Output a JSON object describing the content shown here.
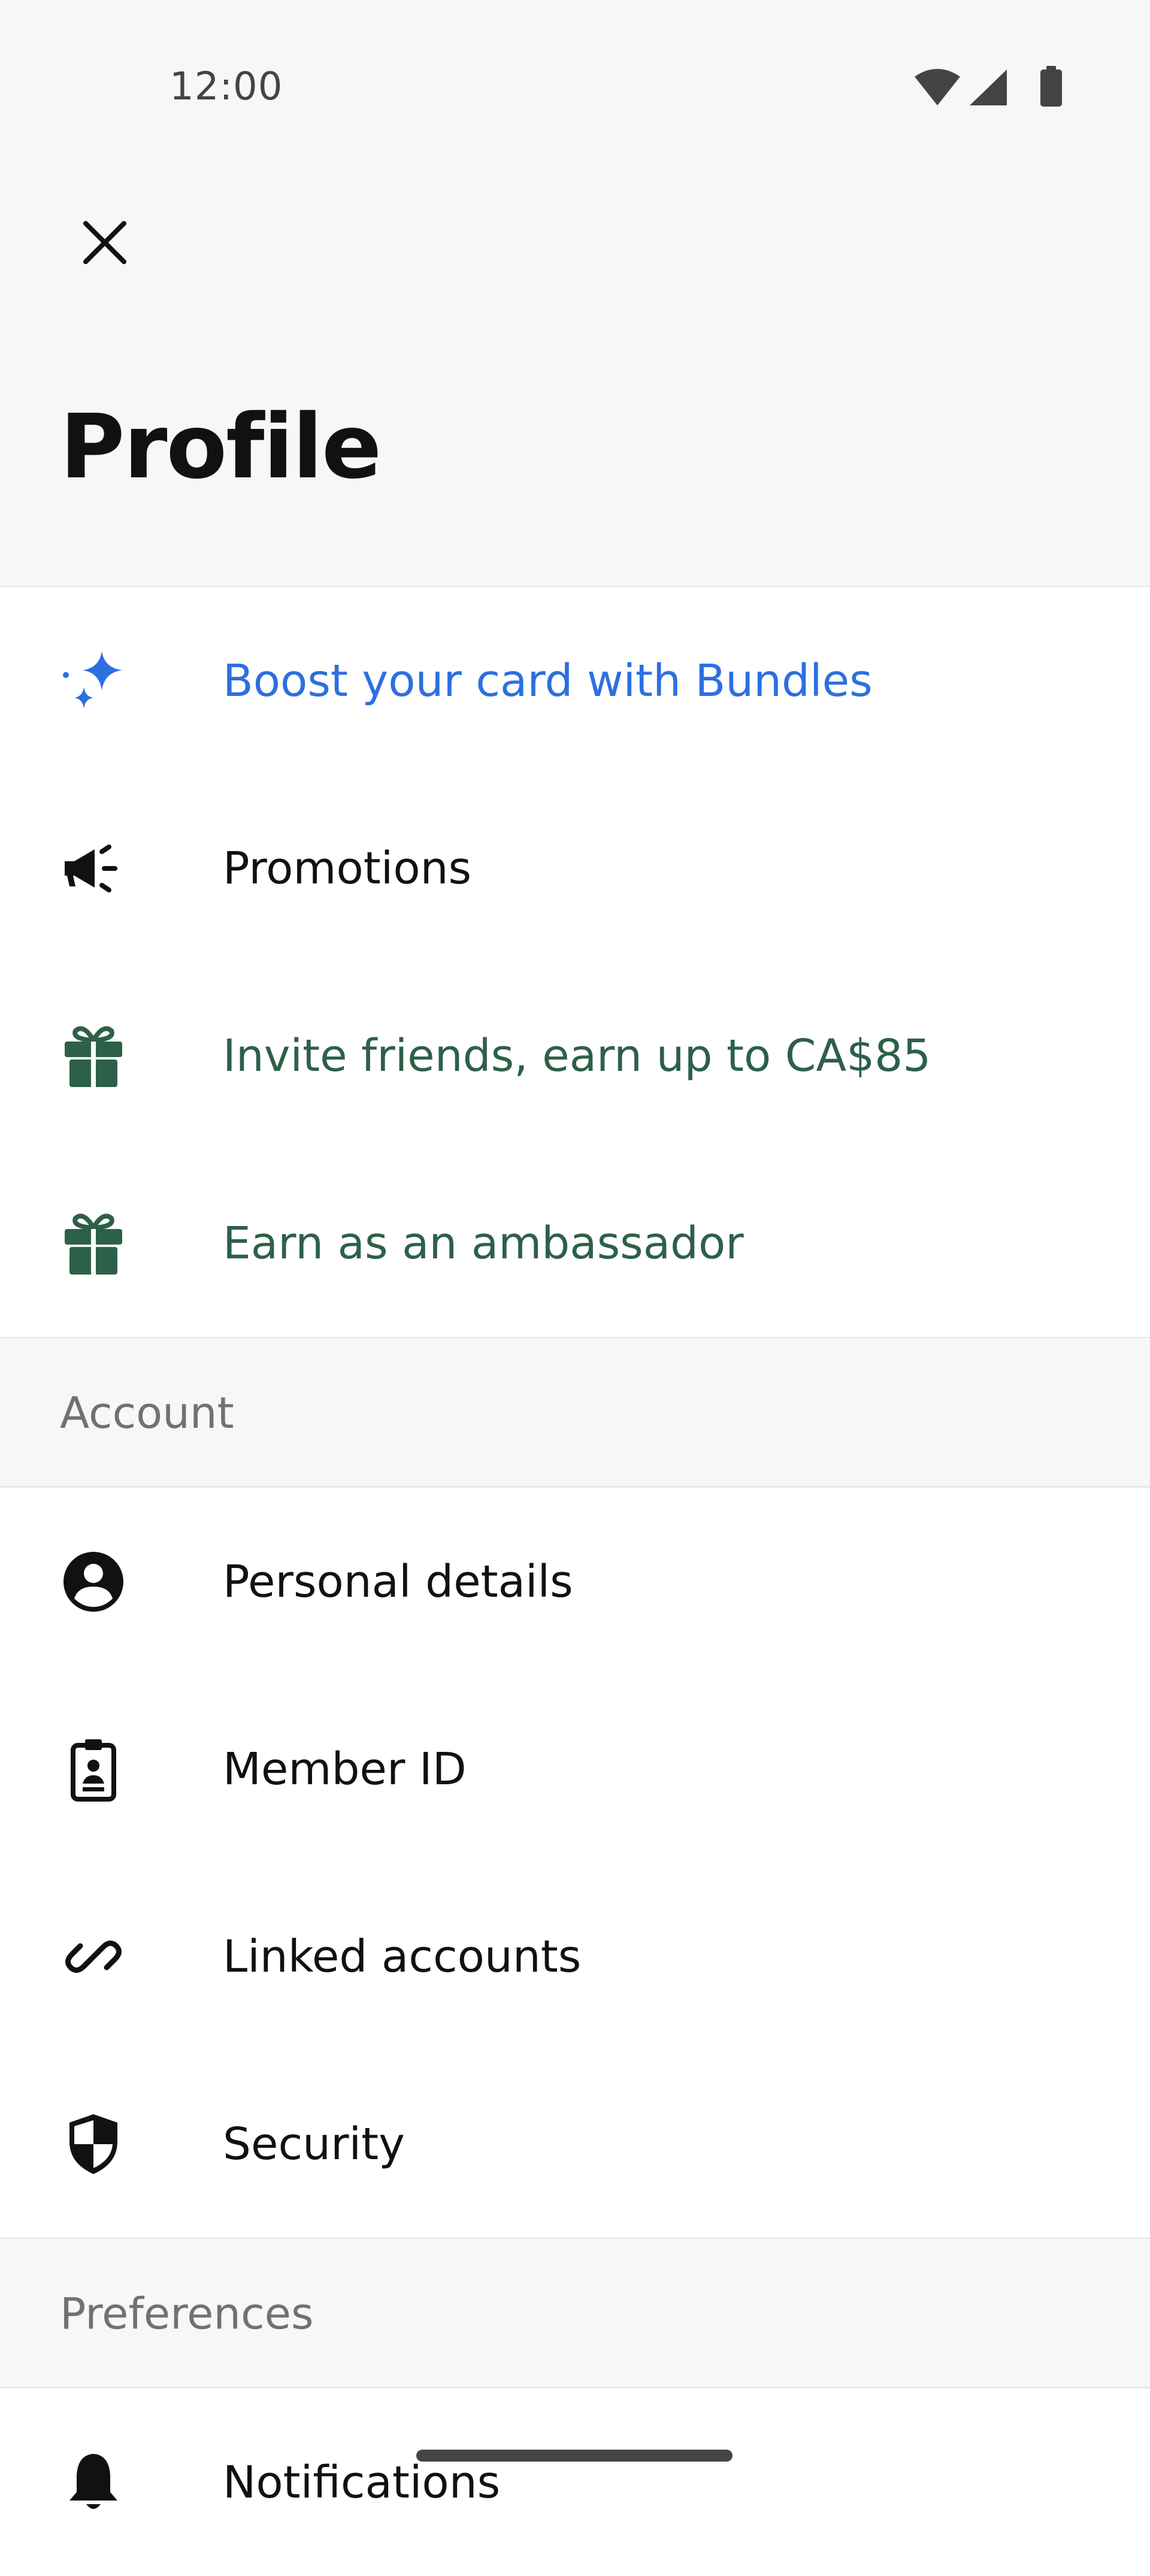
{
  "status_bar": {
    "time": "12:00",
    "icons": [
      "wifi-icon",
      "cellular-signal-icon",
      "battery-icon"
    ]
  },
  "header": {
    "close_icon": "close-icon",
    "title": "Profile"
  },
  "promo_items": [
    {
      "label": "Boost your card with Bundles",
      "icon": "sparkle-icon",
      "color": "#2d6fdf"
    },
    {
      "label": "Promotions",
      "icon": "megaphone-icon",
      "color": "#111111"
    },
    {
      "label": "Invite friends, earn up to CA$85",
      "icon": "gift-icon",
      "color": "#2d6049"
    },
    {
      "label": "Earn as an ambassador",
      "icon": "gift-icon",
      "color": "#2d6049"
    }
  ],
  "sections": {
    "account": {
      "title": "Account",
      "items": [
        {
          "label": "Personal details",
          "icon": "user-circle-icon"
        },
        {
          "label": "Member ID",
          "icon": "id-badge-icon"
        },
        {
          "label": "Linked accounts",
          "icon": "link-icon"
        },
        {
          "label": "Security",
          "icon": "shield-icon"
        }
      ]
    },
    "preferences": {
      "title": "Preferences",
      "items": [
        {
          "label": "Notifications",
          "icon": "bell-icon"
        }
      ]
    }
  },
  "colors": {
    "accent_blue": "#2d6fdf",
    "accent_green": "#2d6049",
    "section_bg": "#f6f7f7",
    "section_text": "#6f7173"
  }
}
